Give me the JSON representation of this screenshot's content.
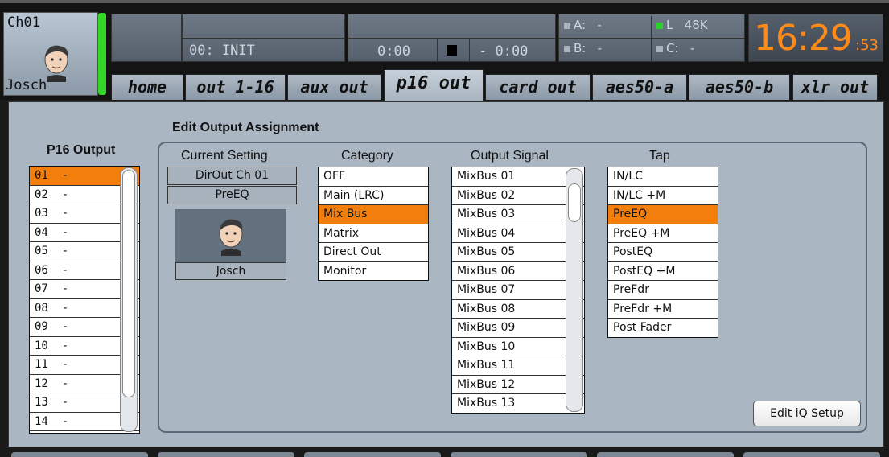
{
  "channel": {
    "number": "Ch01",
    "name": "Josch",
    "icon": "head-avatar-icon",
    "meter_color": "#35d62a"
  },
  "scene": {
    "name": "00: INIT"
  },
  "tape": {
    "elapsed": "0:00",
    "remaining": "- 0:00",
    "stop_icon": "stop-icon"
  },
  "sources": [
    {
      "label": "A:",
      "value": "-"
    },
    {
      "label": "L",
      "value": "48K"
    },
    {
      "label": "B:",
      "value": "-"
    },
    {
      "label": "C:",
      "value": "-"
    }
  ],
  "clock": {
    "time": "16:29",
    "seconds": ":53",
    "color": "#ff8a18"
  },
  "tabs": [
    {
      "label": "home"
    },
    {
      "label": "out 1-16"
    },
    {
      "label": "aux out"
    },
    {
      "label": "p16 out",
      "active": true
    },
    {
      "label": "card out"
    },
    {
      "label": "aes50-a"
    },
    {
      "label": "aes50-b"
    },
    {
      "label": "xlr out"
    }
  ],
  "edit_title": "Edit Output Assignment",
  "p16_output": {
    "title": "P16 Output",
    "selected_index": 0,
    "items": [
      "01  -",
      "02  -",
      "03  -",
      "04  -",
      "05  -",
      "06  -",
      "07  -",
      "08  -",
      "09  -",
      "10  -",
      "11  -",
      "12  -",
      "13  -",
      "14  -"
    ]
  },
  "current_setting": {
    "title": "Current Setting",
    "source": "DirOut Ch 01",
    "tap": "PreEQ",
    "name": "Josch"
  },
  "category": {
    "title": "Category",
    "selected_index": 2,
    "items": [
      "OFF",
      "Main (LRC)",
      "Mix Bus",
      "Matrix",
      "Direct Out",
      "Monitor"
    ]
  },
  "output_signal": {
    "title": "Output Signal",
    "items": [
      "MixBus 01",
      "MixBus 02",
      "MixBus 03",
      "MixBus 04",
      "MixBus 05",
      "MixBus 06",
      "MixBus 07",
      "MixBus 08",
      "MixBus 09",
      "MixBus 10",
      "MixBus 11",
      "MixBus 12",
      "MixBus 13"
    ]
  },
  "tap": {
    "title": "Tap",
    "selected_index": 2,
    "items": [
      "IN/LC",
      "IN/LC +M",
      "PreEQ",
      "PreEQ +M",
      "PostEQ",
      "PostEQ +M",
      "PreFdr",
      "PreFdr +M",
      "Post Fader"
    ]
  },
  "buttons": {
    "edit_iq": "Edit iQ Setup"
  },
  "colors": {
    "selection": "#f27f0c",
    "panel": "#aab6c2"
  }
}
